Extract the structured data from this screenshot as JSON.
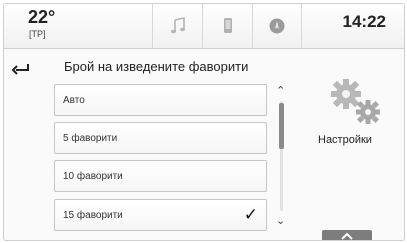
{
  "status": {
    "temperature": "22°",
    "temperature_unit": "[TP]",
    "clock": "14:22"
  },
  "app_tabs": [
    {
      "icon": "music-note-icon"
    },
    {
      "icon": "phone-icon"
    },
    {
      "icon": "navigation-icon"
    }
  ],
  "header": {
    "back_icon": "back-arrow-icon",
    "title": "Брой на изведените фаворити"
  },
  "list": {
    "items": [
      {
        "label": "Авто",
        "selected": false
      },
      {
        "label": "5 фаворити",
        "selected": false
      },
      {
        "label": "10 фаворити",
        "selected": false
      },
      {
        "label": "15 фаворити",
        "selected": true
      }
    ],
    "check_mark": "✓"
  },
  "scrollbar": {
    "up_glyph": "⌃",
    "down_glyph": "⌄"
  },
  "settings": {
    "label": "Настройки",
    "icon": "gears-icon"
  },
  "bottom_handle": {
    "icon": "chevron-up-icon"
  }
}
